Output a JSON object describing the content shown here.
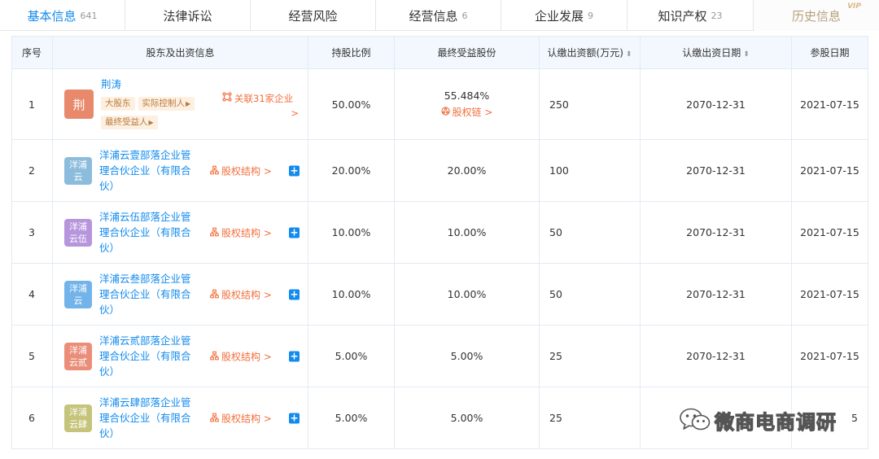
{
  "tabs": [
    {
      "label": "基本信息",
      "count": "641",
      "active": true
    },
    {
      "label": "法律诉讼",
      "count": ""
    },
    {
      "label": "经营风险",
      "count": ""
    },
    {
      "label": "经营信息",
      "count": "6"
    },
    {
      "label": "企业发展",
      "count": "9"
    },
    {
      "label": "知识产权",
      "count": "23"
    },
    {
      "label": "历史信息",
      "count": "",
      "badge": "VIP"
    }
  ],
  "table": {
    "headers": {
      "index": "序号",
      "shareholder": "股东及出资信息",
      "ratio": "持股比例",
      "beneficial": "最终受益股份",
      "amount": "认缴出资额(万元)",
      "amount_sort": "⬍",
      "date": "认缴出资日期",
      "date_sort": "⬍",
      "join": "参股日期"
    },
    "rows": [
      {
        "index": "1",
        "avatar_text": "荆",
        "avatar_color": "#e8896c",
        "name": "荆涛",
        "tags": [
          "大股东",
          "实际控制人",
          "最终受益人"
        ],
        "link": "关联31家企业",
        "link_arrow": ">",
        "ratio": "50.00%",
        "beneficial": "55.484%",
        "beneficial_link": "股权链 >",
        "amount": "250",
        "date": "2070-12-31",
        "join": "2021-07-15"
      },
      {
        "index": "2",
        "avatar_text": "洋浦云",
        "avatar_color": "#8cbcdc",
        "name": "洋浦云壹部落企业管理合伙企业（有限合伙）",
        "link": "股权结构 >",
        "plus": "+",
        "ratio": "20.00%",
        "beneficial": "20.00%",
        "amount": "100",
        "date": "2070-12-31",
        "join": "2021-07-15"
      },
      {
        "index": "3",
        "avatar_text": "洋浦云伍",
        "avatar_color": "#b695dc",
        "name": "洋浦云伍部落企业管理合伙企业（有限合伙）",
        "link": "股权结构 >",
        "plus": "+",
        "ratio": "10.00%",
        "beneficial": "10.00%",
        "amount": "50",
        "date": "2070-12-31",
        "join": "2021-07-15"
      },
      {
        "index": "4",
        "avatar_text": "洋浦云",
        "avatar_color": "#72b3ea",
        "name": "洋浦云叁部落企业管理合伙企业（有限合伙）",
        "link": "股权结构 >",
        "plus": "+",
        "ratio": "10.00%",
        "beneficial": "10.00%",
        "amount": "50",
        "date": "2070-12-31",
        "join": "2021-07-15"
      },
      {
        "index": "5",
        "avatar_text": "洋浦云贰",
        "avatar_color": "#ea8e7a",
        "name": "洋浦云贰部落企业管理合伙企业（有限合伙）",
        "link": "股权结构 >",
        "plus": "+",
        "ratio": "5.00%",
        "beneficial": "5.00%",
        "amount": "25",
        "date": "2070-12-31",
        "join": "2021-07-15"
      },
      {
        "index": "6",
        "avatar_text": "洋浦云肆",
        "avatar_color": "#c5c47a",
        "name": "洋浦云肆部落企业管理合伙企业（有限合伙）",
        "link": "股权结构 >",
        "plus": "+",
        "ratio": "5.00%",
        "beneficial": "5.00%",
        "amount": "25",
        "date": "",
        "join": "5"
      }
    ]
  },
  "watermark": {
    "text": "微商电商调研",
    "icon": "wechat-icon"
  }
}
